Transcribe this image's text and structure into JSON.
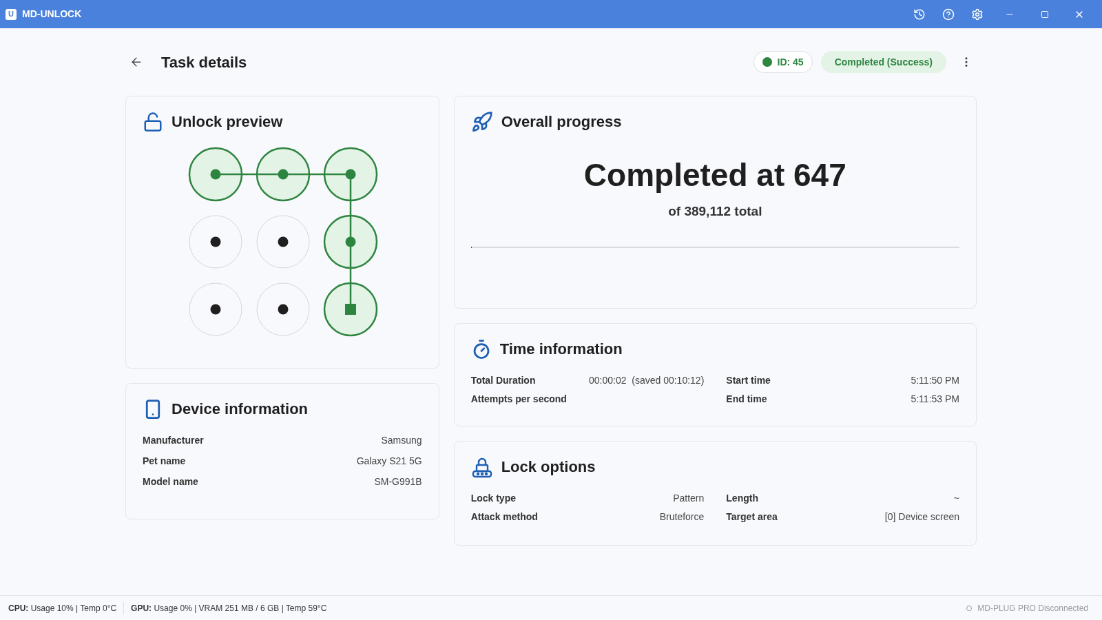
{
  "window": {
    "title": "MD-UNLOCK",
    "logo": "U"
  },
  "header": {
    "title": "Task details",
    "id_badge": {
      "label": "ID: 45",
      "color": "#2e8540"
    },
    "status_badge": "Completed (Success)"
  },
  "unlock_preview": {
    "title": "Unlock preview",
    "nodes": [
      {
        "selected": true,
        "end": false
      },
      {
        "selected": true,
        "end": false
      },
      {
        "selected": true,
        "end": false
      },
      {
        "selected": false,
        "end": false
      },
      {
        "selected": false,
        "end": false
      },
      {
        "selected": true,
        "end": false
      },
      {
        "selected": false,
        "end": false
      },
      {
        "selected": false,
        "end": false
      },
      {
        "selected": true,
        "end": true
      }
    ]
  },
  "device_information": {
    "title": "Device information",
    "rows": [
      {
        "label": "Manufacturer",
        "value": "Samsung"
      },
      {
        "label": "Pet name",
        "value": "Galaxy S21 5G"
      },
      {
        "label": "Model name",
        "value": "SM-G991B"
      }
    ]
  },
  "overall_progress": {
    "title": "Overall progress",
    "headline": "Completed at 647",
    "subline": "of 389,112 total",
    "level": 0.0017
  },
  "time_information": {
    "title": "Time information",
    "rows": [
      {
        "label": "Total Duration",
        "value": "00:00:02  (saved 00:10:12)"
      },
      {
        "label": "Start time",
        "value": "5:11:50 PM"
      },
      {
        "label": "Attempts per second"
      },
      {
        "label": "End time",
        "value": "5:11:53 PM"
      }
    ]
  },
  "lock_options": {
    "title": "Lock options",
    "rows": [
      {
        "label": "Lock type",
        "value": "Pattern"
      },
      {
        "label": "Length",
        "value": "~"
      },
      {
        "label": "Attack method",
        "value": "Bruteforce"
      },
      {
        "label": "Target area",
        "value": "[0] Device screen"
      }
    ]
  },
  "status_bar": {
    "items": [
      "**CPU:** Usage 10% | Temp 0°C",
      "**GPU:** Usage 0% | VRAM 251 MB / 6 GB | Temp 59°C"
    ],
    "connection": "MD-PLUG PRO Disconnected"
  }
}
